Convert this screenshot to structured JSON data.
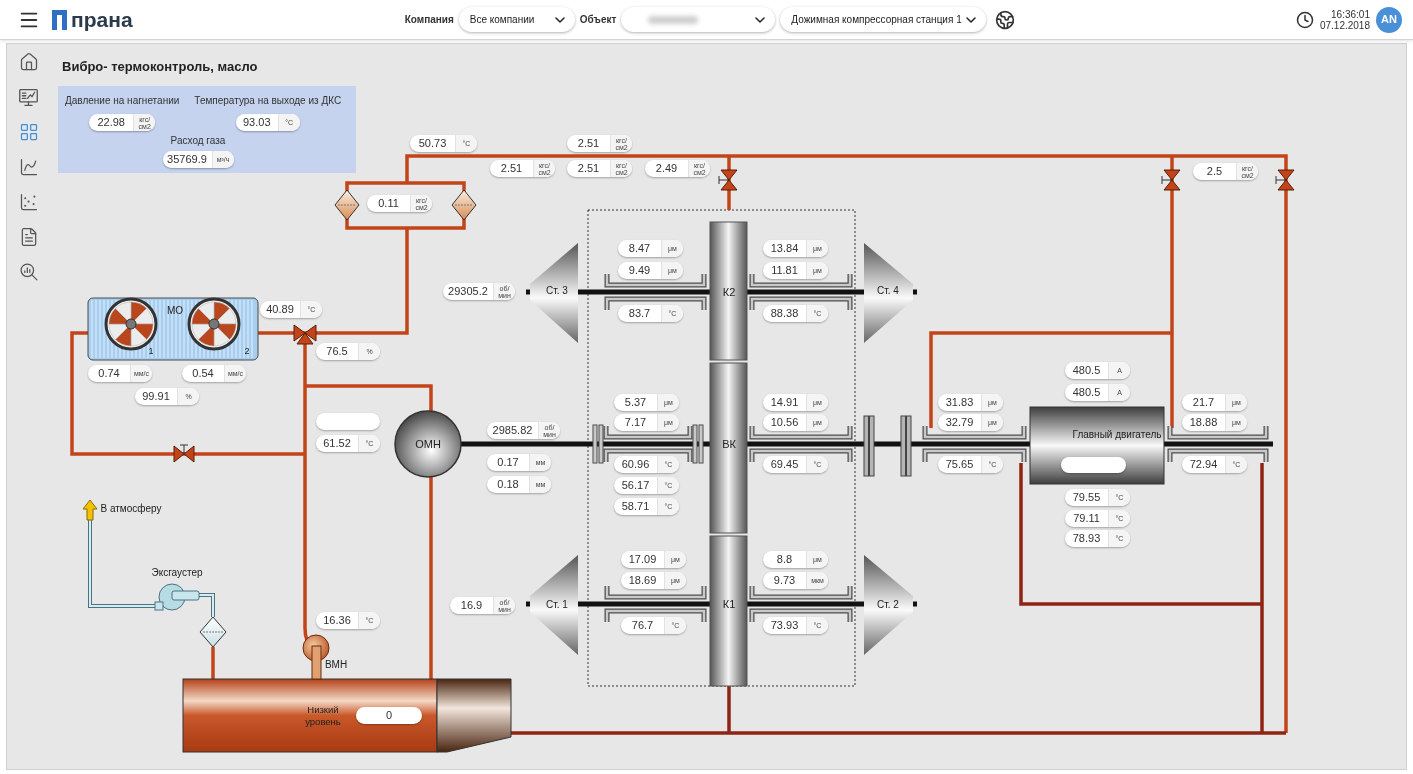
{
  "header": {
    "brand": "прана",
    "selects": [
      {
        "label": "Компания",
        "value": "Все компании",
        "blurred": false
      },
      {
        "label": "Объект",
        "blurred": true
      },
      {
        "value": "Дожимная компрессорная станция 1",
        "blurred": false
      }
    ],
    "time": "16:36:01",
    "date": "07.12.2018",
    "user_initials": "AN"
  },
  "sidebar": {
    "items": [
      {
        "selected": false
      },
      {
        "selected": false
      },
      {
        "selected": true
      },
      {
        "selected": false
      },
      {
        "selected": false
      },
      {
        "selected": false
      },
      {
        "selected": false
      }
    ]
  },
  "page_title": "Вибро- термоконтроль, масло",
  "summary": [
    {
      "label": "Давление на нагнетании",
      "value": "22.98",
      "unit": "кгс/ см2"
    },
    {
      "label": "Температура на выходе из ДКС",
      "value": "93.03",
      "unit": "°C"
    },
    {
      "label": "Расход газа",
      "value": "35769.9",
      "unit": "м³/ч"
    }
  ],
  "diagram": {
    "labels": [
      "Ст. 3",
      "К2",
      "Ст. 4",
      "МО",
      "1",
      "2",
      "ОМН",
      "ВК",
      "Главный двигатель",
      "В атмосферу",
      "Эксгаустер",
      "Ст. 1",
      "К1",
      "Ст. 2",
      "ВМН",
      "Низкий уровень"
    ],
    "readouts": [
      {
        "value": "50.73",
        "unit": "°C"
      },
      {
        "value": "2.51",
        "unit": "кгс/ см2"
      },
      {
        "value": "2.51",
        "unit": "кгс/ см2"
      },
      {
        "value": "2.51",
        "unit": "кгс/ см2"
      },
      {
        "value": "2.49",
        "unit": "кгс/ см2"
      },
      {
        "value": "0.11",
        "unit": "кгс/ см2"
      },
      {
        "value": "2.5",
        "unit": "кгс/ см2"
      },
      {
        "value": "40.89",
        "unit": "°C"
      },
      {
        "value": "76.5",
        "unit": "%"
      },
      {
        "value": "0.74",
        "unit": "мм/с"
      },
      {
        "value": "0.54",
        "unit": "мм/с"
      },
      {
        "value": "99.91",
        "unit": "%"
      },
      {
        "value": "61.52",
        "unit": "°C"
      },
      {
        "value": "29305.2",
        "unit": "об/ мин"
      },
      {
        "value": "2985.82",
        "unit": "об/ мин"
      },
      {
        "value": "0.17",
        "unit": "мм"
      },
      {
        "value": "0.18",
        "unit": "мм"
      },
      {
        "value": "16.9",
        "unit": "об/ мин"
      },
      {
        "value": "16.36",
        "unit": "°C"
      },
      {
        "value": "8.47",
        "unit": "μм"
      },
      {
        "value": "9.49",
        "unit": "μм"
      },
      {
        "value": "83.7",
        "unit": "°C"
      },
      {
        "value": "13.84",
        "unit": "μм"
      },
      {
        "value": "11.81",
        "unit": "μм"
      },
      {
        "value": "88.38",
        "unit": "°C"
      },
      {
        "value": "5.37",
        "unit": "μм"
      },
      {
        "value": "7.17",
        "unit": "μм"
      },
      {
        "value": "60.96",
        "unit": "°C"
      },
      {
        "value": "56.17",
        "unit": "°C"
      },
      {
        "value": "58.71",
        "unit": "°C"
      },
      {
        "value": "14.91",
        "unit": "μм"
      },
      {
        "value": "10.56",
        "unit": "μм"
      },
      {
        "value": "69.45",
        "unit": "°C"
      },
      {
        "value": "17.09",
        "unit": "μм"
      },
      {
        "value": "18.69",
        "unit": "μм"
      },
      {
        "value": "76.7",
        "unit": "°C"
      },
      {
        "value": "8.8",
        "unit": "μм"
      },
      {
        "value": "9.73",
        "unit": "мкм"
      },
      {
        "value": "73.93",
        "unit": "°C"
      },
      {
        "value": "480.5",
        "unit": "A"
      },
      {
        "value": "480.5",
        "unit": "A"
      },
      {
        "value": "31.83",
        "unit": "μм"
      },
      {
        "value": "32.79",
        "unit": "μм"
      },
      {
        "value": "75.65",
        "unit": "°C"
      },
      {
        "value": "21.7",
        "unit": "μм"
      },
      {
        "value": "18.88",
        "unit": "μм"
      },
      {
        "value": "72.94",
        "unit": "°C"
      },
      {
        "value": "79.55",
        "unit": "°C"
      },
      {
        "value": "79.11",
        "unit": "°C"
      },
      {
        "value": "78.93",
        "unit": "°C"
      },
      {
        "value": "0"
      }
    ]
  }
}
